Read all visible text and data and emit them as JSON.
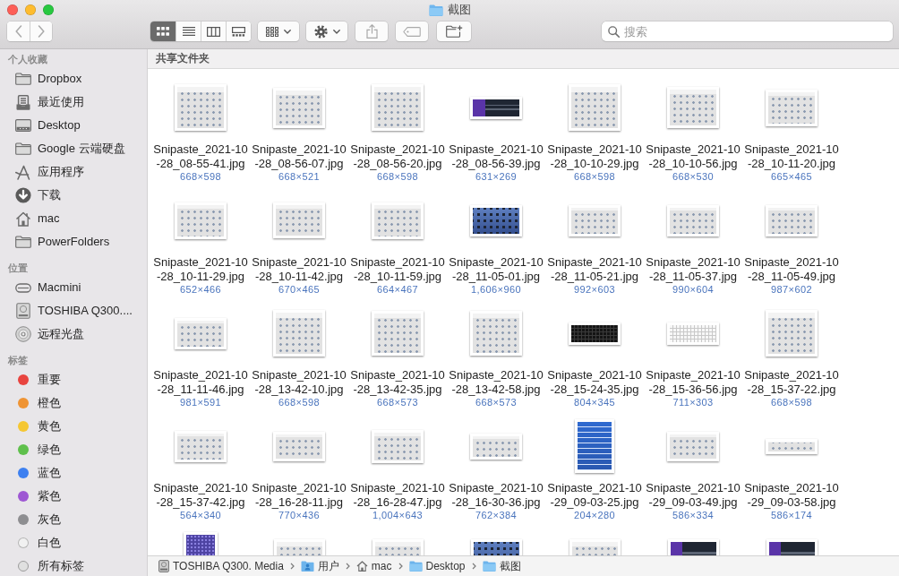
{
  "window": {
    "title": "截图"
  },
  "toolbar": {
    "nav": [
      {
        "kind": "back",
        "disabled": true
      },
      {
        "kind": "forward",
        "disabled": true
      }
    ],
    "view_modes": [
      {
        "kind": "icons",
        "selected": true
      },
      {
        "kind": "list",
        "selected": false
      },
      {
        "kind": "columns",
        "selected": false
      },
      {
        "kind": "gallery",
        "selected": false
      }
    ],
    "actions": [
      {
        "kind": "arrange",
        "disabled": false
      },
      {
        "kind": "action",
        "disabled": false
      },
      {
        "kind": "share",
        "disabled": true
      },
      {
        "kind": "tag",
        "disabled": true
      },
      {
        "kind": "new-folder",
        "disabled": false
      }
    ],
    "search": {
      "placeholder": "搜索"
    }
  },
  "sidebar": {
    "sections": [
      {
        "title": "个人收藏",
        "items": [
          {
            "label": "Dropbox",
            "kind": "folder"
          },
          {
            "label": "最近使用",
            "kind": "recents"
          },
          {
            "label": "Desktop",
            "kind": "desktop"
          },
          {
            "label": "Google 云端硬盘",
            "kind": "folder"
          },
          {
            "label": "应用程序",
            "kind": "apps"
          },
          {
            "label": "下载",
            "kind": "download"
          },
          {
            "label": "mac",
            "kind": "home"
          },
          {
            "label": "PowerFolders",
            "kind": "folder"
          }
        ]
      },
      {
        "title": "位置",
        "items": [
          {
            "label": "Macmini",
            "kind": "server"
          },
          {
            "label": "TOSHIBA Q300....",
            "kind": "drive"
          },
          {
            "label": "远程光盘",
            "kind": "disc"
          }
        ]
      },
      {
        "title": "标签",
        "items": [
          {
            "label": "重要",
            "kind": "tag",
            "color": "#e8443f"
          },
          {
            "label": "橙色",
            "kind": "tag",
            "color": "#ef9434"
          },
          {
            "label": "黄色",
            "kind": "tag",
            "color": "#f5c733"
          },
          {
            "label": "绿色",
            "kind": "tag",
            "color": "#5fc04c"
          },
          {
            "label": "蓝色",
            "kind": "tag",
            "color": "#3e80f0"
          },
          {
            "label": "紫色",
            "kind": "tag",
            "color": "#9e57d3"
          },
          {
            "label": "灰色",
            "kind": "tag",
            "color": "#8e8e91"
          },
          {
            "label": "白色",
            "kind": "tag",
            "color": "#f1f1f1"
          },
          {
            "label": "所有标签",
            "kind": "all"
          }
        ]
      }
    ]
  },
  "content": {
    "header": "共享文件夹",
    "files": [
      {
        "name": "Snipaste_2021-10-28_08-55-41.jpg",
        "size": "668×598",
        "kind": "light"
      },
      {
        "name": "Snipaste_2021-10-28_08-56-07.jpg",
        "size": "668×521",
        "kind": "light"
      },
      {
        "name": "Snipaste_2021-10-28_08-56-20.jpg",
        "size": "668×598",
        "kind": "light"
      },
      {
        "name": "Snipaste_2021-10-28_08-56-39.jpg",
        "size": "631×269",
        "kind": "dark"
      },
      {
        "name": "Snipaste_2021-10-28_10-10-29.jpg",
        "size": "668×598",
        "kind": "light"
      },
      {
        "name": "Snipaste_2021-10-28_10-10-56.jpg",
        "size": "668×530",
        "kind": "light"
      },
      {
        "name": "Snipaste_2021-10-28_10-11-20.jpg",
        "size": "665×465",
        "kind": "light"
      },
      {
        "name": "Snipaste_2021-10-28_10-11-29.jpg",
        "size": "652×466",
        "kind": "light"
      },
      {
        "name": "Snipaste_2021-10-28_10-11-42.jpg",
        "size": "670×465",
        "kind": "light"
      },
      {
        "name": "Snipaste_2021-10-28_10-11-59.jpg",
        "size": "664×467",
        "kind": "light"
      },
      {
        "name": "Snipaste_2021-10-28_11-05-01.jpg",
        "size": "1,606×960",
        "kind": "blue"
      },
      {
        "name": "Snipaste_2021-10-28_11-05-21.jpg",
        "size": "992×603",
        "kind": "light"
      },
      {
        "name": "Snipaste_2021-10-28_11-05-37.jpg",
        "size": "990×604",
        "kind": "light"
      },
      {
        "name": "Snipaste_2021-10-28_11-05-49.jpg",
        "size": "987×602",
        "kind": "light"
      },
      {
        "name": "Snipaste_2021-10-28_11-11-46.jpg",
        "size": "981×591",
        "kind": "light"
      },
      {
        "name": "Snipaste_2021-10-28_13-42-10.jpg",
        "size": "668×598",
        "kind": "light"
      },
      {
        "name": "Snipaste_2021-10-28_13-42-35.jpg",
        "size": "668×573",
        "kind": "light"
      },
      {
        "name": "Snipaste_2021-10-28_13-42-58.jpg",
        "size": "668×573",
        "kind": "light"
      },
      {
        "name": "Snipaste_2021-10-28_15-24-35.jpg",
        "size": "804×345",
        "kind": "keys-dark"
      },
      {
        "name": "Snipaste_2021-10-28_15-36-56.jpg",
        "size": "711×303",
        "kind": "keys-light"
      },
      {
        "name": "Snipaste_2021-10-28_15-37-22.jpg",
        "size": "668×598",
        "kind": "light"
      },
      {
        "name": "Snipaste_2021-10-28_15-37-42.jpg",
        "size": "564×340",
        "kind": "light"
      },
      {
        "name": "Snipaste_2021-10-28_16-28-11.jpg",
        "size": "770×436",
        "kind": "light"
      },
      {
        "name": "Snipaste_2021-10-28_16-28-47.jpg",
        "size": "1,004×643",
        "kind": "light"
      },
      {
        "name": "Snipaste_2021-10-28_16-30-36.jpg",
        "size": "762×384",
        "kind": "light"
      },
      {
        "name": "Snipaste_2021-10-29_09-03-25.jpg",
        "size": "204×280",
        "kind": "menu"
      },
      {
        "name": "Snipaste_2021-10-29_09-03-49.jpg",
        "size": "586×334",
        "kind": "light"
      },
      {
        "name": "Snipaste_2021-10-29_09-03-58.jpg",
        "size": "586×174",
        "kind": "light"
      },
      {
        "kind": "purple"
      },
      {
        "kind": "light"
      },
      {
        "kind": "light"
      },
      {
        "kind": "blue"
      },
      {
        "kind": "light"
      },
      {
        "kind": "dark"
      },
      {
        "kind": "dark"
      }
    ]
  },
  "path_bar": [
    {
      "label": "TOSHIBA Q300. Media",
      "kind": "drive"
    },
    {
      "label": "用户",
      "kind": "users-folder"
    },
    {
      "label": "mac",
      "kind": "home"
    },
    {
      "label": "Desktop",
      "kind": "folder"
    },
    {
      "label": "截图",
      "kind": "folder"
    }
  ]
}
